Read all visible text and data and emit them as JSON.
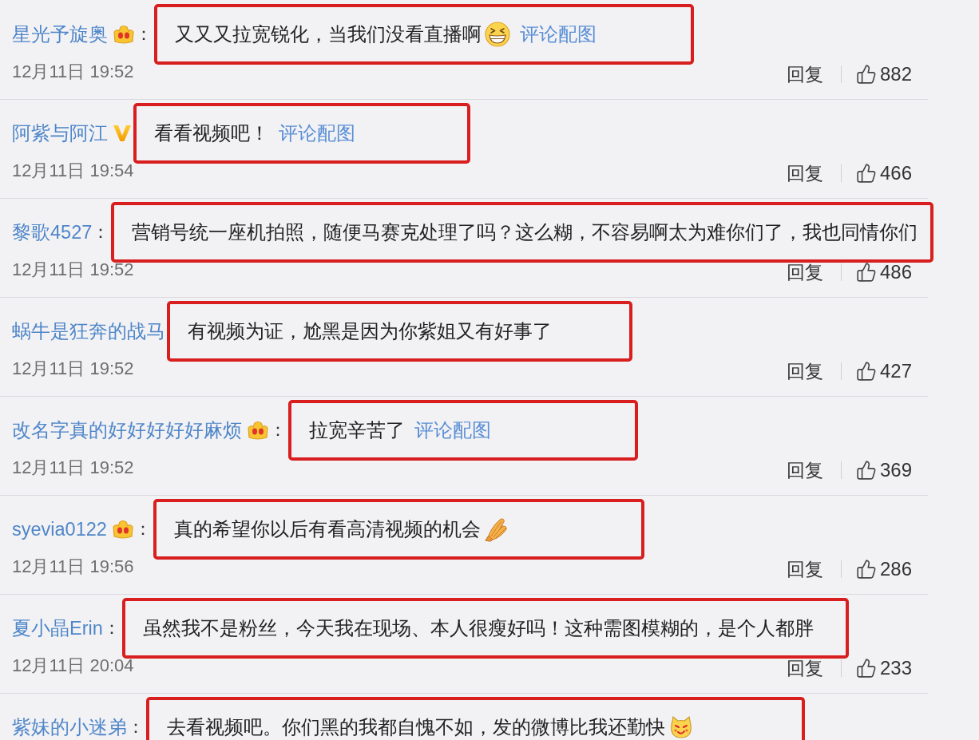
{
  "comments": [
    {
      "username": "星光予旋奥",
      "crown": true,
      "verified": false,
      "separator": "：",
      "text": "又又又拉宽锐化，当我们没看直播啊",
      "emoji": true,
      "link": "评论配图",
      "time": "12月11日 19:52",
      "reply": "回复",
      "likes": "882"
    },
    {
      "username": "阿紫与阿江",
      "crown": false,
      "verified": true,
      "text": "看看视频吧！",
      "emoji": false,
      "link": "评论配图",
      "time": "12月11日 19:54",
      "reply": "回复",
      "likes": "466"
    },
    {
      "username": "黎歌4527",
      "crown": false,
      "verified": false,
      "separator": "：",
      "text": "营销号统一座机拍照，随便马赛克处理了吗？这么糊，不容易啊太为难你们了，我也同情你们",
      "emoji": false,
      "time": "12月11日 19:52",
      "reply": "回复",
      "likes": "486"
    },
    {
      "username": "蜗牛是狂奔的战马",
      "crown": false,
      "verified": false,
      "text": "有视频为证，尬黑是因为你紫姐又有好事了",
      "emoji": false,
      "time": "12月11日 19:52",
      "reply": "回复",
      "likes": "427"
    },
    {
      "username": "改名字真的好好好好好麻烦",
      "crown": true,
      "verified": false,
      "separator": "：",
      "text": "拉宽辛苦了",
      "emoji": false,
      "link": "评论配图",
      "time": "12月11日 19:52",
      "reply": "回复",
      "likes": "369"
    },
    {
      "username": "syevia0122",
      "crown": true,
      "verified": false,
      "separator": "：",
      "text": "真的希望你以后有看高清视频的机会",
      "emoji": true,
      "time": "12月11日 19:56",
      "reply": "回复",
      "likes": "286"
    },
    {
      "username": "夏小晶Erin",
      "crown": false,
      "verified": false,
      "separator": "：",
      "text": "虽然我不是粉丝，今天我在现场、本人很瘦好吗！这种需图模糊的，是个人都胖",
      "emoji": false,
      "time": "12月11日 20:04",
      "reply": "回复",
      "likes": "233"
    },
    {
      "username": "紫妹的小迷弟",
      "crown": false,
      "verified": false,
      "separator": "：",
      "text": "去看视频吧。你们黑的我都自愧不如，发的微博比我还勤快",
      "emoji": true
    }
  ]
}
